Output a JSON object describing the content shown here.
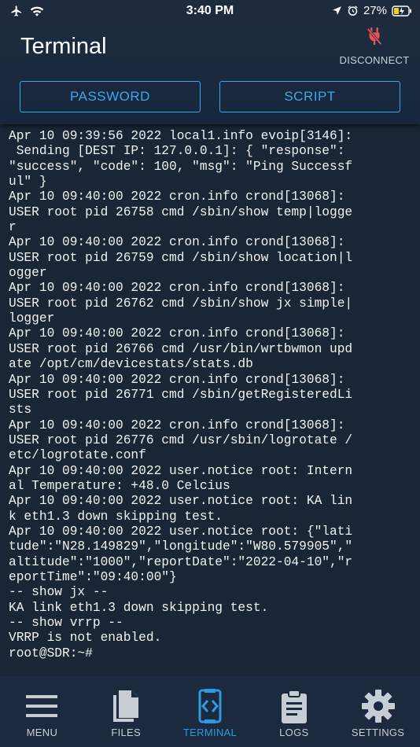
{
  "status_bar": {
    "time": "3:40 PM",
    "battery": "27%"
  },
  "header": {
    "title": "Terminal",
    "disconnect_label": "DISCONNECT"
  },
  "actions": {
    "password_label": "PASSWORD",
    "script_label": "SCRIPT"
  },
  "terminal_lines": [
    "Apr 10 09:39:56 2022 local1.info evoip[3146]:",
    " Sending [DEST IP: 127.0.0.1]: { \"response\":",
    "\"success\", \"code\": 100, \"msg\": \"Ping Successf",
    "ul\" }",
    "Apr 10 09:40:00 2022 cron.info crond[13068]:",
    "USER root pid 26758 cmd /sbin/show temp|logge",
    "r",
    "Apr 10 09:40:00 2022 cron.info crond[13068]:",
    "USER root pid 26759 cmd /sbin/show location|l",
    "ogger",
    "Apr 10 09:40:00 2022 cron.info crond[13068]:",
    "USER root pid 26762 cmd /sbin/show jx simple|",
    "logger",
    "Apr 10 09:40:00 2022 cron.info crond[13068]:",
    "USER root pid 26766 cmd /usr/bin/wrtbwmon upd",
    "ate /opt/cm/devicestats/stats.db",
    "Apr 10 09:40:00 2022 cron.info crond[13068]:",
    "USER root pid 26771 cmd /sbin/getRegisteredLi",
    "sts",
    "Apr 10 09:40:00 2022 cron.info crond[13068]:",
    "USER root pid 26776 cmd /usr/sbin/logrotate /",
    "etc/logrotate.conf",
    "Apr 10 09:40:00 2022 user.notice root: Intern",
    "al Temperature: +48.0 Celcius",
    "Apr 10 09:40:00 2022 user.notice root: KA lin",
    "k eth1.3 down skipping test.",
    "Apr 10 09:40:00 2022 user.notice root: {\"lati",
    "tude\":\"N28.149829\",\"longitude\":\"W80.579905\",\"",
    "altitude\":\"1000\",\"reportDate\":\"2022-04-10\",\"r",
    "eportTime\":\"09:40:00\"}",
    "-- show jx --",
    "KA link eth1.3 down skipping test.",
    "-- show vrrp --",
    "VRRP is not enabled.",
    "root@SDR:~#"
  ],
  "tabs": [
    {
      "label": "MENU",
      "icon": "menu-icon",
      "active": false
    },
    {
      "label": "FILES",
      "icon": "files-icon",
      "active": false
    },
    {
      "label": "TERMINAL",
      "icon": "terminal-icon",
      "active": true
    },
    {
      "label": "LOGS",
      "icon": "logs-icon",
      "active": false
    },
    {
      "label": "SETTINGS",
      "icon": "gear-icon",
      "active": false
    }
  ],
  "colors": {
    "accent": "#2f9ae0",
    "disconnect_icon": "#e8545a",
    "background": "#1a2636"
  }
}
